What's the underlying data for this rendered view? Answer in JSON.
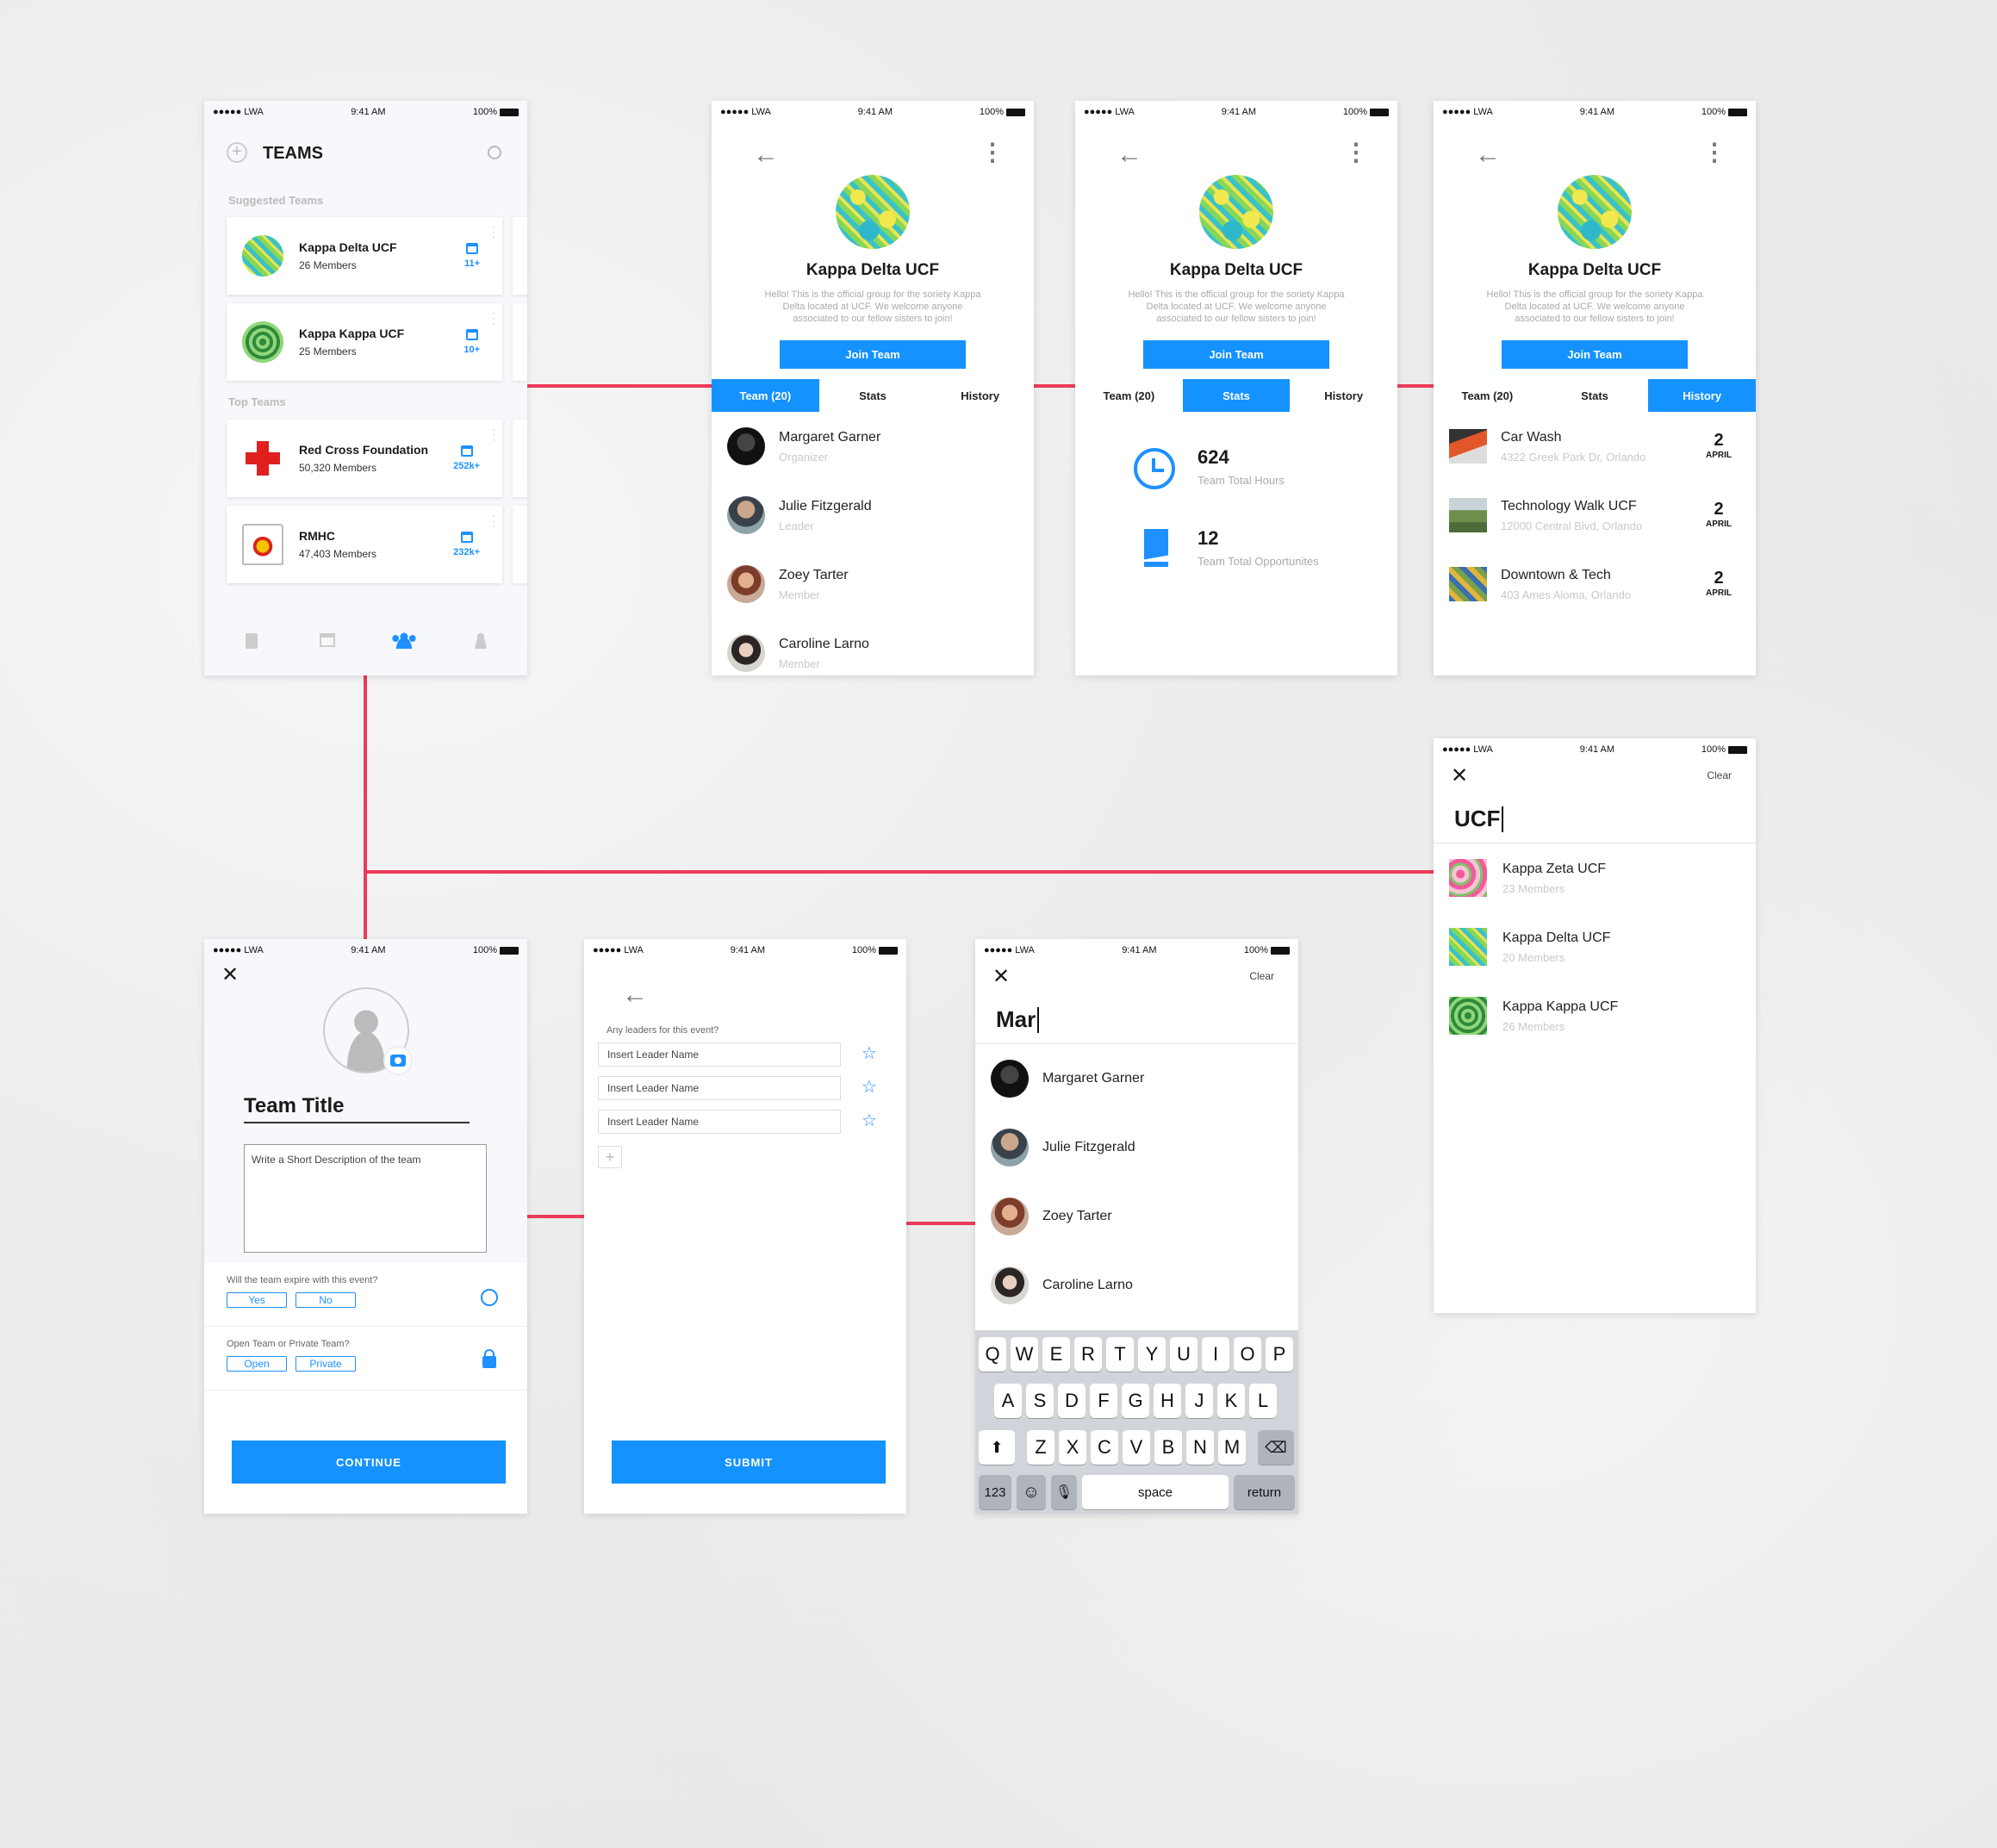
{
  "status": {
    "carrier": "●●●●● LWA",
    "time": "9:41 AM",
    "battery": "100%"
  },
  "teams": {
    "title": "TEAMS",
    "suggested_label": "Suggested Teams",
    "top_label": "Top Teams",
    "cards": [
      {
        "name": "Kappa Delta UCF",
        "members": "26 Members",
        "count": "11+"
      },
      {
        "name": "Kappa Kappa UCF",
        "members": "25 Members",
        "count": "10+"
      },
      {
        "name": "Red Cross Foundation",
        "members": "50,320 Members",
        "count": "252k+"
      },
      {
        "name": "RMHC",
        "members": "47,403 Members",
        "count": "232k+"
      }
    ]
  },
  "profile": {
    "name": "Kappa Delta UCF",
    "description": "Hello! This is the official group for the soriety Kappa Delta located at UCF. We welcome anyone associated to our fellow sisters to join!",
    "join": "Join Team",
    "tab_team": "Team (20)",
    "tab_stats": "Stats",
    "tab_history": "History"
  },
  "members": [
    {
      "name": "Margaret Garner",
      "role": "Organizer"
    },
    {
      "name": "Julie Fitzgerald",
      "role": "Leader"
    },
    {
      "name": "Zoey Tarter",
      "role": "Member"
    },
    {
      "name": "Caroline Larno",
      "role": "Member"
    }
  ],
  "stats": [
    {
      "value": "624",
      "label": "Team Total Hours"
    },
    {
      "value": "12",
      "label": "Team Total Opportunites"
    }
  ],
  "history": [
    {
      "name": "Car Wash",
      "addr": "4322 Greek Park Dr, Orlando",
      "day": "2",
      "month": "APRIL"
    },
    {
      "name": "Technology Walk UCF",
      "addr": "12000 Central Blvd, Orlando",
      "day": "2",
      "month": "APRIL"
    },
    {
      "name": "Downtown & Tech",
      "addr": "403 Ames Aloma, Orlando",
      "day": "2",
      "month": "APRIL"
    }
  ],
  "search": {
    "query": "UCF",
    "clear": "Clear",
    "results": [
      {
        "name": "Kappa Zeta UCF",
        "members": "23 Members"
      },
      {
        "name": "Kappa Delta UCF",
        "members": "20 Members"
      },
      {
        "name": "Kappa Kappa UCF",
        "members": "26 Members"
      }
    ]
  },
  "create": {
    "title": "Team Title",
    "desc_placeholder": "Write a Short Description of the team",
    "q1": "Will the team expire with this event?",
    "yes": "Yes",
    "no": "No",
    "q2": "Open Team or Private Team?",
    "open": "Open",
    "private": "Private",
    "continue": "CONTINUE"
  },
  "leaders": {
    "question": "Any leaders for this event?",
    "placeholder": "Insert Leader Name",
    "add": "+",
    "submit": "SUBMIT"
  },
  "member_search": {
    "query": "Mar",
    "clear": "Clear"
  },
  "keyboard": {
    "row1": [
      "Q",
      "W",
      "E",
      "R",
      "T",
      "Y",
      "U",
      "I",
      "O",
      "P"
    ],
    "row2": [
      "A",
      "S",
      "D",
      "F",
      "G",
      "H",
      "J",
      "K",
      "L"
    ],
    "row3": [
      "Z",
      "X",
      "C",
      "V",
      "B",
      "N",
      "M"
    ],
    "num": "123",
    "space": "space",
    "return": "return"
  }
}
